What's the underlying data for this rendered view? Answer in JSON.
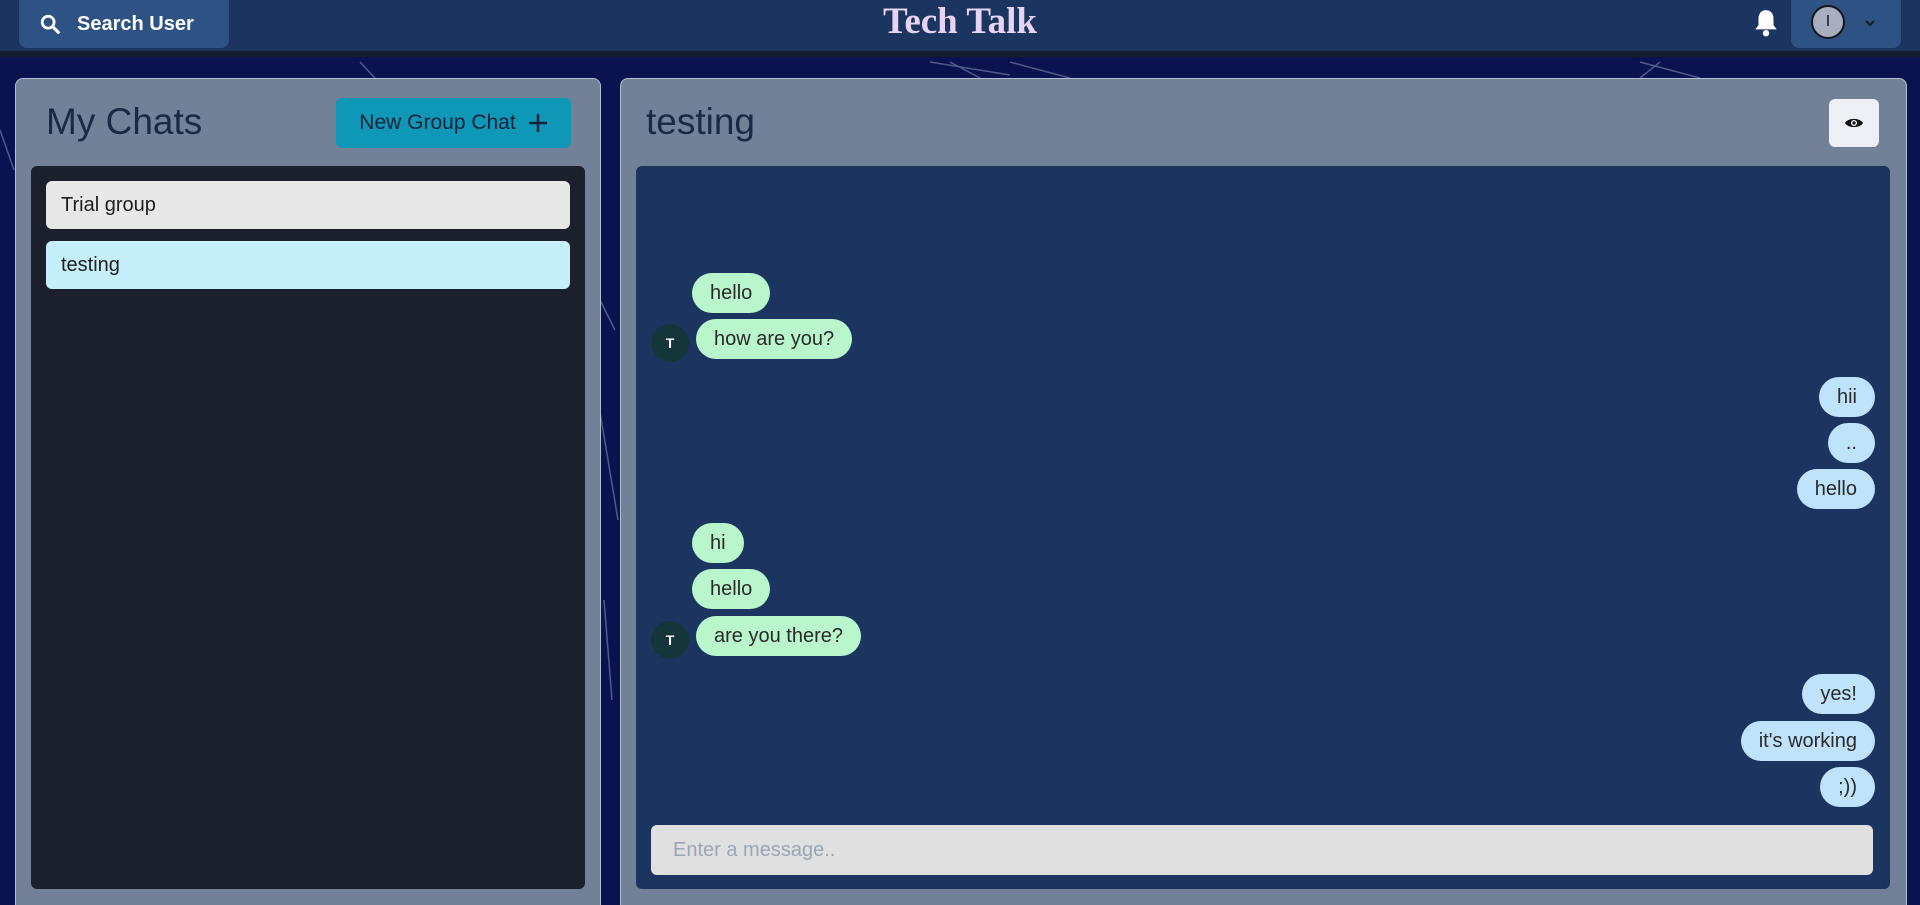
{
  "header": {
    "search_label": "Search User",
    "app_title": "Tech Talk",
    "user_initial": "I"
  },
  "sidebar": {
    "title": "My Chats",
    "new_group_label": "New Group Chat",
    "chats": [
      {
        "name": "Trial group",
        "selected": false
      },
      {
        "name": "testing",
        "selected": true
      }
    ]
  },
  "chat": {
    "title": "testing",
    "input_placeholder": "Enter a message..",
    "messages": [
      {
        "text": "hello",
        "from": "other",
        "avatar": ""
      },
      {
        "text": "how are you?",
        "from": "other",
        "avatar": "T"
      },
      {
        "text": "hii",
        "from": "me",
        "avatar": ""
      },
      {
        "text": "..",
        "from": "me",
        "avatar": ""
      },
      {
        "text": "hello",
        "from": "me",
        "avatar": ""
      },
      {
        "text": "hi",
        "from": "other",
        "avatar": ""
      },
      {
        "text": "hello",
        "from": "other",
        "avatar": ""
      },
      {
        "text": "are you there?",
        "from": "other",
        "avatar": "T"
      },
      {
        "text": "yes!",
        "from": "me",
        "avatar": ""
      },
      {
        "text": "it's working",
        "from": "me",
        "avatar": ""
      },
      {
        "text": ";))",
        "from": "me",
        "avatar": ""
      }
    ]
  },
  "colors": {
    "header_bg": "#1c3560",
    "panel_bg": "#728198",
    "accent": "#0f97b8",
    "other_bubble": "#b9f6cb",
    "my_bubble": "#bfe3fb"
  }
}
